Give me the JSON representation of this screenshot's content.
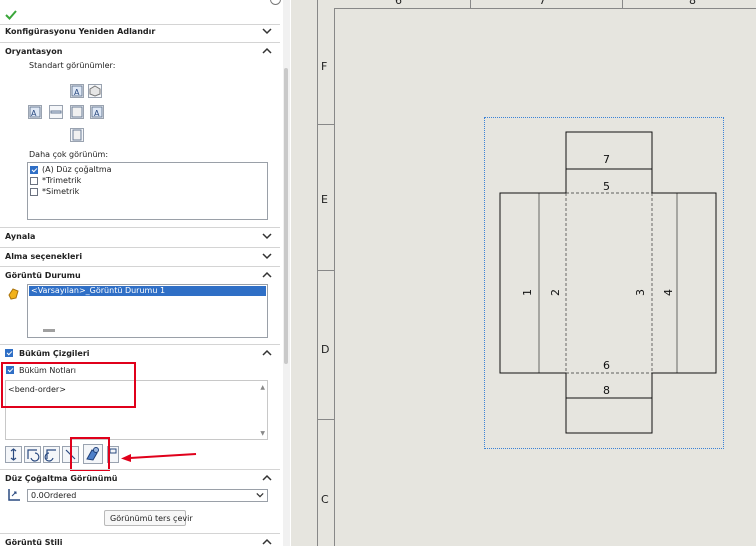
{
  "panel": {
    "top_section_title": "Konfigürasyonu Yeniden Adlandır",
    "orientation": {
      "title": "Oryantasyon",
      "standard_views_label": "Standart görünümler:",
      "more_views_label": "Daha çok görünüm:",
      "more_views_items": [
        {
          "label": "(A) Düz çoğaltma",
          "checked": true
        },
        {
          "label": "*Trimetrik",
          "checked": false
        },
        {
          "label": "*Simetrik",
          "checked": false
        }
      ]
    },
    "mirror": {
      "title": "Aynala"
    },
    "import_options": {
      "title": "Alma seçenekleri"
    },
    "display_state": {
      "title": "Görüntü Durumu",
      "selected_item": "<Varsayılan>_Görüntü Durumu 1"
    },
    "bend_lines": {
      "title": "Büküm Çizgileri",
      "checked": true
    },
    "bend_notes": {
      "label": "Büküm Notları",
      "checked": true,
      "text_value": "<bend-order>"
    },
    "flat_pattern_view": {
      "title": "Düz Çoğaltma Görünümü",
      "select_value": "0.0Ordered",
      "flip_button": "Görünümü ters çevir"
    },
    "display_style": {
      "title": "Görüntü Stili"
    }
  },
  "sheet": {
    "top_labels": [
      "6",
      "7",
      "8"
    ],
    "left_labels": [
      "F",
      "E",
      "D",
      "C"
    ],
    "bend_labels": [
      "1",
      "2",
      "3",
      "4",
      "5",
      "6",
      "7",
      "8"
    ]
  },
  "colors": {
    "accent_red": "#e0001b",
    "selection_blue": "#2f6fc6",
    "sheet_bg": "#e6e5df",
    "confirm_green": "#3aa63a"
  }
}
